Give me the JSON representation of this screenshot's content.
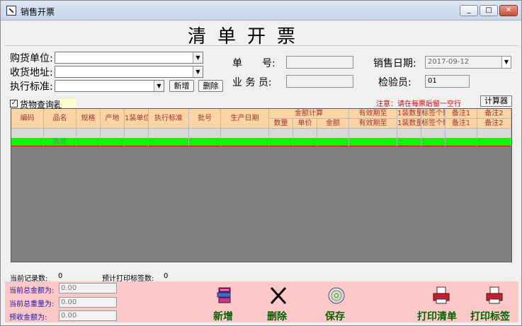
{
  "window": {
    "title": "销售开票",
    "btn_min": "_",
    "btn_max": "□",
    "btn_close": "✕"
  },
  "header": {
    "title": "清单开票"
  },
  "form": {
    "buyer_label": "购货单位:",
    "buyer_value": "",
    "address_label": "收货地址:",
    "address_value": "",
    "standard_label": "执行标准:",
    "standard_value": "",
    "add_label": "新增",
    "delete_label": "删除",
    "doc_no_label": "单　　号:",
    "doc_no_value": "",
    "salesman_label": "业 务 员:",
    "salesman_value": "",
    "sale_date_label": "销售日期:",
    "sale_date_value": "2017-09-12",
    "inspector_label": "检验员:",
    "inspector_value": "01",
    "goods_query_label": "货物查询器",
    "note": "注意：请在每票后留一空行",
    "calculator_label": "计算器"
  },
  "grid": {
    "headers": {
      "code": "编码",
      "name": "品名",
      "spec": "规格",
      "origin": "产地",
      "pack_unit": "1装单位",
      "standard": "执行标准",
      "batch": "批号",
      "prod_date": "生产日期",
      "amount_group": "金额计算",
      "qty": "数量",
      "price": "单价",
      "amount": "金额",
      "expiry_top": "有效期至",
      "expiry_bottom": "有效期至",
      "pack_qty_top": "1装数量",
      "pack_qty_bottom": "1装数量",
      "sticker_top": "标签个数",
      "sticker_bottom": "标签个数",
      "remark1_top": "备注1",
      "remark1_bottom": "备注1",
      "remark2_top": "备注2",
      "remark2_bottom": "备注2"
    },
    "total_label": "合计"
  },
  "status": {
    "record_count_label": "当前记录数:",
    "record_count": "0",
    "label_count_label": "预计打印标签数:",
    "label_count": "0"
  },
  "totals": {
    "total_amount_label": "当前总金额为:",
    "total_amount": "0.00",
    "total_weight_label": "当前总重量为:",
    "total_weight": "0.00",
    "prepaid_label": "预收金额为:",
    "prepaid": "0.00"
  },
  "actions": {
    "add": "新增",
    "delete": "删除",
    "save": "保存",
    "print_list": "打印清单",
    "print_label": "打印标签"
  }
}
